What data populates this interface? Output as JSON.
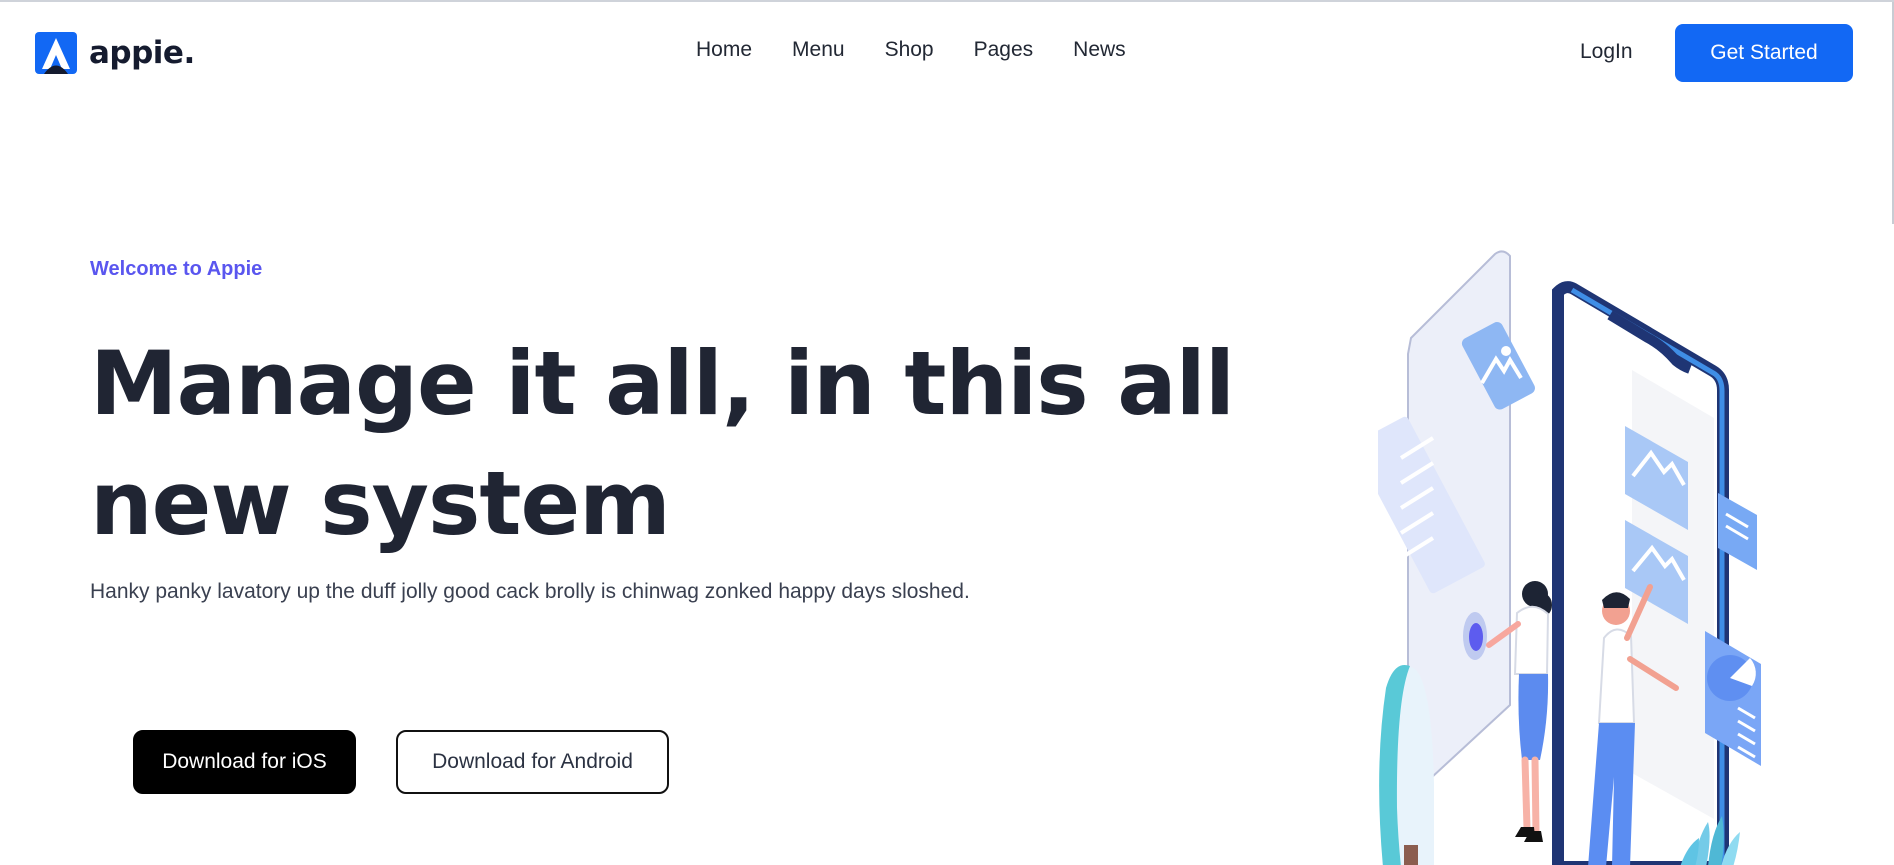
{
  "header": {
    "logo": {
      "text": "appie.",
      "icon": "appie-logo-icon",
      "brand_color": "#1268f4"
    },
    "nav": {
      "home": "Home",
      "menu": "Menu",
      "shop": "Shop",
      "pages": "Pages",
      "news": "News"
    },
    "login": "LogIn",
    "get_started": "Get Started"
  },
  "hero": {
    "eyebrow": "Welcome to Appie",
    "headline": "Manage it all, in this all new system",
    "subtitle": "Hanky panky lavatory up the duff jolly good cack brolly is chinwag zonked happy days sloshed.",
    "buttons": {
      "ios": "Download for iOS",
      "android": "Download for Android"
    },
    "illustration": {
      "icon": "hero-phone-illustration",
      "accent": "#5a56ef",
      "phone_blue": "#2f7fe0"
    }
  },
  "colors": {
    "eyebrow": "#5a56ef",
    "primary_button": "#1268f4",
    "dark_text": "#202533"
  }
}
